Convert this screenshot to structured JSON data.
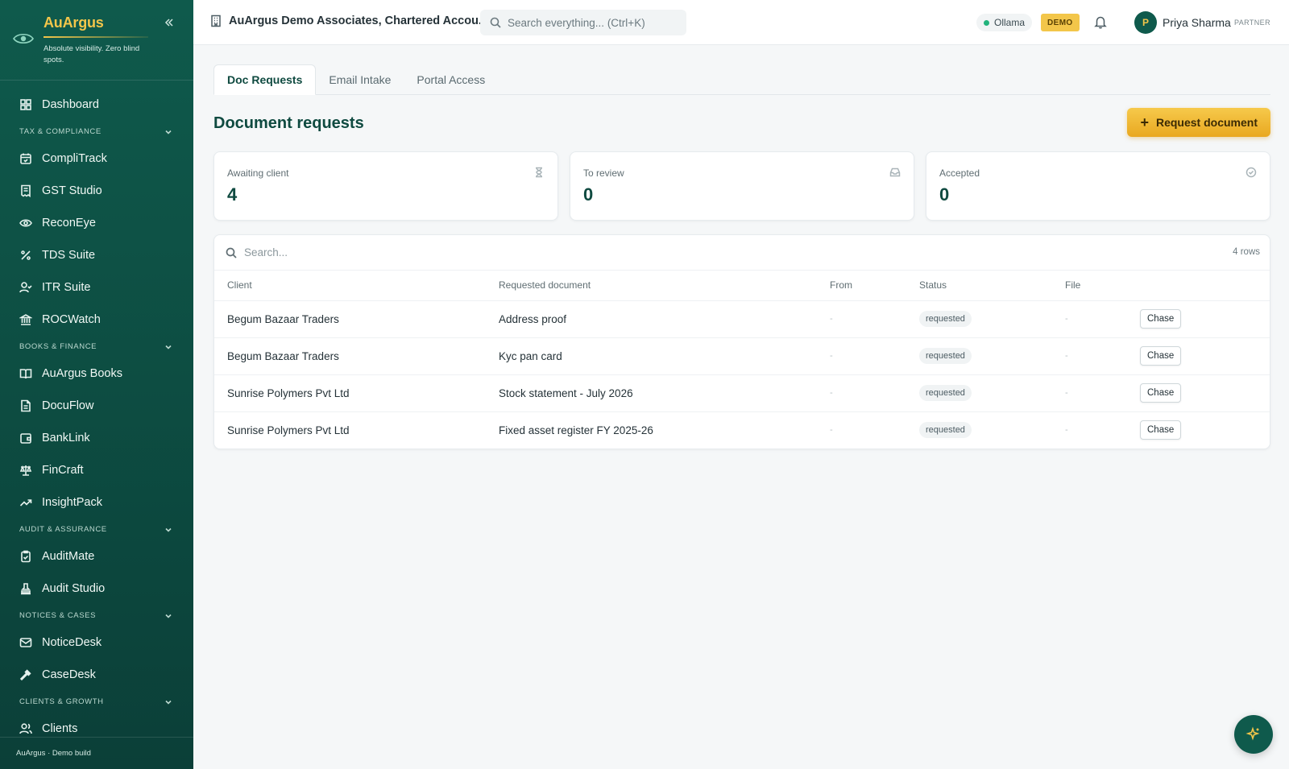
{
  "brand": {
    "name": "AuArgus",
    "tagline": "Absolute visibility. Zero blind spots."
  },
  "sidebar": {
    "top_item": {
      "label": "Dashboard",
      "icon": "grid-icon"
    },
    "sections": [
      {
        "title": "TAX & COMPLIANCE",
        "items": [
          {
            "label": "CompliTrack",
            "icon": "calendar-check-icon"
          },
          {
            "label": "GST Studio",
            "icon": "receipt-icon"
          },
          {
            "label": "ReconEye",
            "icon": "eye-icon"
          },
          {
            "label": "TDS Suite",
            "icon": "percent-icon"
          },
          {
            "label": "ITR Suite",
            "icon": "user-check-icon"
          },
          {
            "label": "ROCWatch",
            "icon": "landmark-icon"
          }
        ]
      },
      {
        "title": "BOOKS & FINANCE",
        "items": [
          {
            "label": "AuArgus Books",
            "icon": "book-open-icon"
          },
          {
            "label": "DocuFlow",
            "icon": "file-text-icon"
          },
          {
            "label": "BankLink",
            "icon": "wallet-icon"
          },
          {
            "label": "FinCraft",
            "icon": "scale-icon"
          },
          {
            "label": "InsightPack",
            "icon": "trending-up-icon"
          }
        ]
      },
      {
        "title": "AUDIT & ASSURANCE",
        "items": [
          {
            "label": "AuditMate",
            "icon": "clipboard-check-icon"
          },
          {
            "label": "Audit Studio",
            "icon": "stamp-icon"
          }
        ]
      },
      {
        "title": "NOTICES & CASES",
        "items": [
          {
            "label": "NoticeDesk",
            "icon": "mail-icon"
          },
          {
            "label": "CaseDesk",
            "icon": "gavel-icon"
          }
        ]
      },
      {
        "title": "CLIENTS & GROWTH",
        "items": [
          {
            "label": "Clients",
            "icon": "users-icon"
          }
        ]
      }
    ],
    "footer": "AuArgus · Demo build"
  },
  "topbar": {
    "org_name": "AuArgus Demo Associates, Chartered Accou...",
    "search_placeholder": "Search everything...  (Ctrl+K)",
    "ollama_label": "Ollama",
    "demo_label": "DEMO",
    "user": {
      "initial": "P",
      "name": "Priya Sharma",
      "role": "PARTNER"
    }
  },
  "tabs": [
    {
      "label": "Doc Requests",
      "active": true
    },
    {
      "label": "Email Intake",
      "active": false
    },
    {
      "label": "Portal Access",
      "active": false
    }
  ],
  "page": {
    "title": "Document requests",
    "request_button": "Request document"
  },
  "stats": [
    {
      "label": "Awaiting client",
      "value": "4",
      "icon": "hourglass-icon"
    },
    {
      "label": "To review",
      "value": "0",
      "icon": "inbox-icon"
    },
    {
      "label": "Accepted",
      "value": "0",
      "icon": "check-circle-icon"
    }
  ],
  "table": {
    "search_placeholder": "Search...",
    "row_count": "4 rows",
    "columns": [
      "Client",
      "Requested document",
      "From",
      "Status",
      "File",
      ""
    ],
    "rows": [
      {
        "client": "Begum Bazaar Traders",
        "document": "Address proof",
        "from": "-",
        "status": "requested",
        "file": "-",
        "action": "Chase"
      },
      {
        "client": "Begum Bazaar Traders",
        "document": "Kyc pan card",
        "from": "-",
        "status": "requested",
        "file": "-",
        "action": "Chase"
      },
      {
        "client": "Sunrise Polymers Pvt Ltd",
        "document": "Stock statement - July 2026",
        "from": "-",
        "status": "requested",
        "file": "-",
        "action": "Chase"
      },
      {
        "client": "Sunrise Polymers Pvt Ltd",
        "document": "Fixed asset register FY 2025-26",
        "from": "-",
        "status": "requested",
        "file": "-",
        "action": "Chase"
      }
    ]
  },
  "colors": {
    "brand_green": "#0f5a4c",
    "brand_gold": "#f3c64a",
    "status_online": "#22b37c"
  }
}
